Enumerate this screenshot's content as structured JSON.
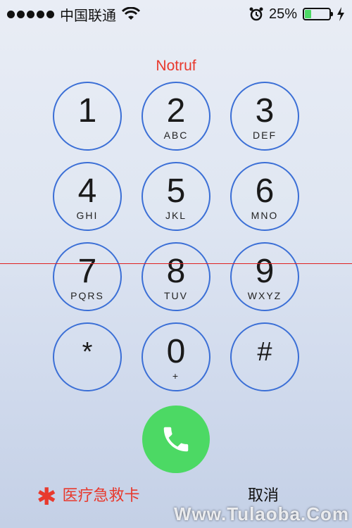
{
  "status_bar": {
    "carrier": "中国联通",
    "battery_text": "25%",
    "battery_level": 0.25,
    "icons": [
      "signal-dots",
      "wifi-icon",
      "alarm-icon",
      "battery-icon",
      "charging-icon"
    ]
  },
  "emergency_label": "Notruf",
  "keypad": [
    {
      "digit": "1",
      "letters": ""
    },
    {
      "digit": "2",
      "letters": "ABC"
    },
    {
      "digit": "3",
      "letters": "DEF"
    },
    {
      "digit": "4",
      "letters": "GHI"
    },
    {
      "digit": "5",
      "letters": "JKL"
    },
    {
      "digit": "6",
      "letters": "MNO"
    },
    {
      "digit": "7",
      "letters": "PQRS"
    },
    {
      "digit": "8",
      "letters": "TUV"
    },
    {
      "digit": "9",
      "letters": "WXYZ"
    },
    {
      "digit": "*",
      "letters": ""
    },
    {
      "digit": "0",
      "letters": "+"
    },
    {
      "digit": "#",
      "letters": ""
    }
  ],
  "call_button_icon": "phone-icon",
  "medical_id": {
    "asterisk": "✱",
    "label": "医疗急救卡"
  },
  "cancel_label": "取消",
  "watermark": "Www.Tulaoba.Com",
  "colors": {
    "accent": "#3b6fd6",
    "call_green": "#4cd964",
    "emergency_red": "#e8392d"
  }
}
